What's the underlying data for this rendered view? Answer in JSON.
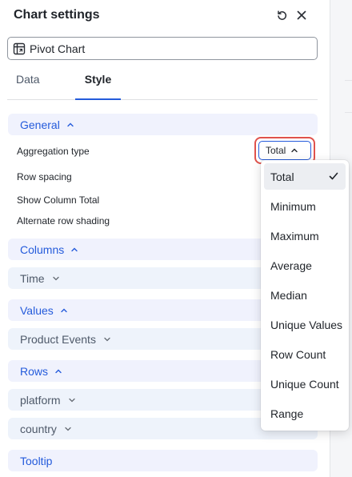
{
  "header": {
    "title": "Chart settings",
    "reset_icon": "reset-icon",
    "close_icon": "close-icon"
  },
  "chart_name": {
    "icon": "pivot-table-icon",
    "value": "Pivot Chart"
  },
  "tabs": [
    {
      "label": "Data",
      "active": false
    },
    {
      "label": "Style",
      "active": true
    }
  ],
  "sections": {
    "general": {
      "label": "General",
      "expanded": true
    },
    "columns": {
      "label": "Columns",
      "expanded": true,
      "fields": [
        "Time"
      ]
    },
    "values": {
      "label": "Values",
      "expanded": true,
      "fields": [
        "Product Events"
      ]
    },
    "rows": {
      "label": "Rows",
      "expanded": true,
      "fields": [
        "platform",
        "country"
      ]
    },
    "tooltip": {
      "label": "Tooltip"
    }
  },
  "general_settings": {
    "aggregation_type_label": "Aggregation type",
    "row_spacing_label": "Row spacing",
    "show_column_total_label": "Show Column Total",
    "alternate_row_shading_label": "Alternate row shading"
  },
  "aggregation": {
    "selected": "Total",
    "options": [
      "Total",
      "Minimum",
      "Maximum",
      "Average",
      "Median",
      "Unique Values",
      "Row Count",
      "Unique Count",
      "Range"
    ]
  },
  "colors": {
    "accent": "#245bdb",
    "highlight_border": "#e0524c",
    "section_bg": "#f0f2fd",
    "field_bg": "#eef3fb"
  }
}
